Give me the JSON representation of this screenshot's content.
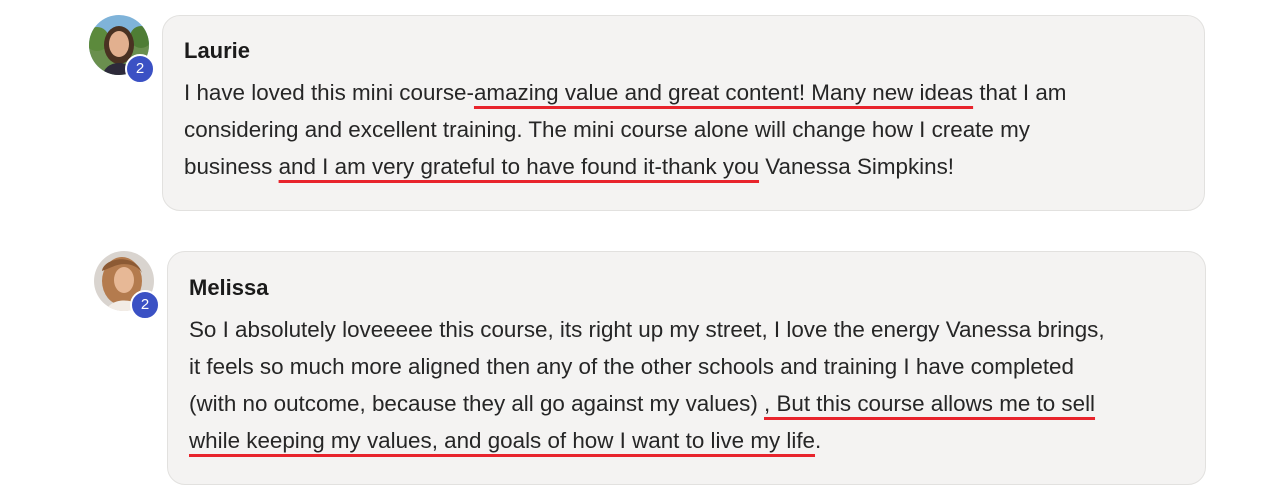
{
  "comments": [
    {
      "author": "Laurie",
      "badge": "2",
      "avatar_icon": "user-photo-avatar",
      "lines": [
        {
          "a": "I have loved this mini course-",
          "h": "amazing value and great content! Many new ideas",
          "b": " that I am"
        },
        {
          "a": "considering and excellent training. The mini course alone will change how I create my",
          "h": "",
          "b": ""
        },
        {
          "a": "business ",
          "h": "and I am very grateful to have found it-thank you",
          "b": " Vanessa Simpkins!"
        }
      ]
    },
    {
      "author": "Melissa",
      "badge": "2",
      "avatar_icon": "user-photo-avatar",
      "lines": [
        {
          "a": "So I absolutely loveeeee this course, its right up my street, I love the energy Vanessa brings,",
          "h": "",
          "b": ""
        },
        {
          "a": "it feels so much more aligned then any of the other schools and training I have completed",
          "h": "",
          "b": ""
        },
        {
          "a": "(with no outcome, because they all go against my values) ",
          "h": ", But this course allows me to sell",
          "b": ""
        },
        {
          "a": "",
          "h": "while keeping my values, and goals of how I want to live my life",
          "b": "."
        }
      ]
    }
  ],
  "colors": {
    "bubble_bg": "#f4f3f2",
    "badge_bg": "#3b51c4",
    "underline": "#e8242c"
  }
}
